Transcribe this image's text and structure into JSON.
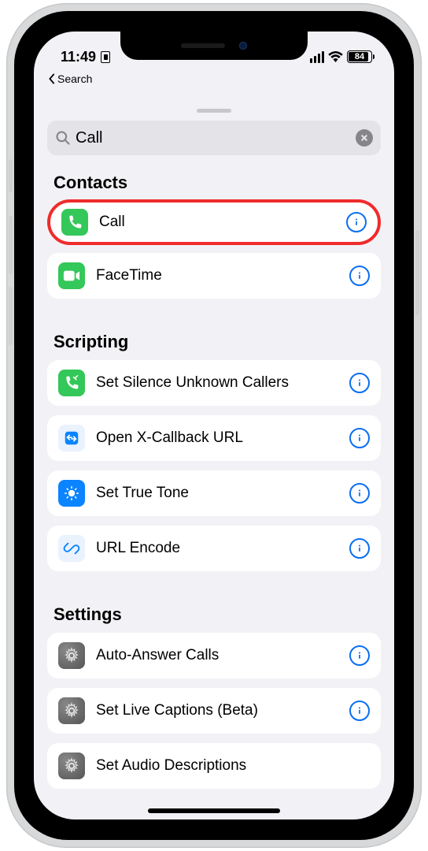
{
  "status": {
    "time": "11:49",
    "battery_pct": "84"
  },
  "back": {
    "label": "Search"
  },
  "search": {
    "value": "Call"
  },
  "sections": [
    {
      "title": "Contacts",
      "items": [
        {
          "label": "Call",
          "highlight": true,
          "icon": "phone",
          "color": "green"
        },
        {
          "label": "FaceTime",
          "icon": "facetime",
          "color": "green"
        }
      ]
    },
    {
      "title": "Scripting",
      "items": [
        {
          "label": "Set Silence Unknown Callers",
          "icon": "silence",
          "color": "green"
        },
        {
          "label": "Open X-Callback URL",
          "icon": "xcallback",
          "color": "bluebox"
        },
        {
          "label": "Set True Tone",
          "icon": "truetone",
          "color": "blue"
        },
        {
          "label": "URL Encode",
          "icon": "link",
          "color": "bluebox"
        }
      ]
    },
    {
      "title": "Settings",
      "items": [
        {
          "label": "Auto-Answer Calls",
          "icon": "gear",
          "color": "gray"
        },
        {
          "label": "Set Live Captions (Beta)",
          "icon": "gear",
          "color": "gray"
        },
        {
          "label": "Set Audio Descriptions",
          "icon": "gear",
          "color": "gray"
        }
      ]
    }
  ]
}
